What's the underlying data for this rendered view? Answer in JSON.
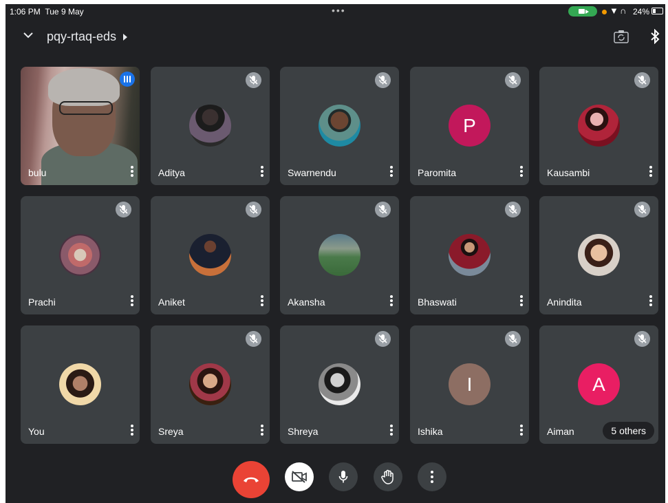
{
  "status_bar": {
    "time": "1:06 PM",
    "date": "Tue 9 May",
    "multitask_dots": "•••",
    "battery": "24%"
  },
  "header": {
    "meeting_code": "pqy-rtaq-eds"
  },
  "tiles": [
    {
      "name": "bulu",
      "type": "video",
      "speaking": true
    },
    {
      "name": "Aditya",
      "type": "photo",
      "muted": true
    },
    {
      "name": "Swarnendu",
      "type": "photo",
      "muted": true
    },
    {
      "name": "Paromita",
      "type": "letter",
      "letter": "P",
      "color": "#c2185b",
      "muted": true
    },
    {
      "name": "Kausambi",
      "type": "photo",
      "muted": true
    },
    {
      "name": "Prachi",
      "type": "photo",
      "muted": true
    },
    {
      "name": "Aniket",
      "type": "photo",
      "muted": true
    },
    {
      "name": "Akansha",
      "type": "photo",
      "muted": true
    },
    {
      "name": "Bhaswati",
      "type": "photo",
      "muted": true
    },
    {
      "name": "Anindita",
      "type": "photo",
      "muted": true
    },
    {
      "name": "You",
      "type": "photo",
      "muted": false
    },
    {
      "name": "Sreya",
      "type": "photo",
      "muted": true
    },
    {
      "name": "Shreya",
      "type": "photo",
      "muted": true
    },
    {
      "name": "Ishika",
      "type": "letter",
      "letter": "I",
      "color": "#8d6e63",
      "muted": true
    },
    {
      "name": "Aiman",
      "type": "letter",
      "letter": "A",
      "color": "#e91e63",
      "muted": true,
      "others_label": "5 others"
    }
  ],
  "controls": [
    "end-call",
    "camera-off",
    "microphone",
    "raise-hand",
    "more-options"
  ],
  "colors": {
    "background": "#202124",
    "tile": "#3c4043",
    "end_call": "#ea4335",
    "speaking": "#1a73e8",
    "camera_indicator": "#34a853"
  }
}
